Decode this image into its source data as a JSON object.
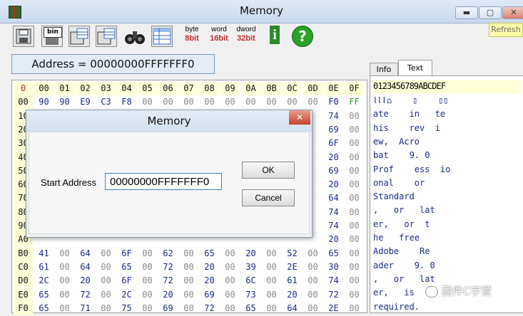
{
  "window": {
    "title": "Memory",
    "min": "▬",
    "max": "▢",
    "close": "✕"
  },
  "toolbar": {
    "byte_top": "byte",
    "byte_bot": "8bit",
    "word_top": "word",
    "word_bot": "16bit",
    "dword_top": "dword",
    "dword_bot": "32bit",
    "bin_label": "bin",
    "info_label": "i",
    "help_label": "?",
    "refresh_label": "Refresh"
  },
  "address": {
    "text": "Address = 00000000FFFFFFF0"
  },
  "tabs": {
    "info": "Info",
    "text": "Text"
  },
  "grid": {
    "corner": "0",
    "cols": [
      "00",
      "01",
      "02",
      "03",
      "04",
      "05",
      "06",
      "07",
      "08",
      "09",
      "0A",
      "0B",
      "0C",
      "0D",
      "0E",
      "0F"
    ],
    "rows": [
      {
        "label": "00",
        "cells": [
          "90",
          "90",
          "E9",
          "C3",
          "F8",
          "00",
          "00",
          "00",
          "00",
          "00",
          "00",
          "00",
          "00",
          "00",
          "F0",
          "FF"
        ]
      },
      {
        "label": "10",
        "cells": [
          "",
          "",
          "",
          "",
          "",
          "",
          "",
          "",
          "",
          "",
          "",
          "",
          "",
          "",
          "74",
          "00"
        ]
      },
      {
        "label": "20",
        "cells": [
          "",
          "",
          "",
          "",
          "",
          "",
          "",
          "",
          "",
          "",
          "",
          "",
          "",
          "",
          "69",
          "00"
        ]
      },
      {
        "label": "30",
        "cells": [
          "",
          "",
          "",
          "",
          "",
          "",
          "",
          "",
          "",
          "",
          "",
          "",
          "",
          "",
          "6F",
          "00"
        ]
      },
      {
        "label": "40",
        "cells": [
          "",
          "",
          "",
          "",
          "",
          "",
          "",
          "",
          "",
          "",
          "",
          "",
          "",
          "",
          "20",
          "00"
        ]
      },
      {
        "label": "50",
        "cells": [
          "",
          "",
          "",
          "",
          "",
          "",
          "",
          "",
          "",
          "",
          "",
          "",
          "",
          "",
          "69",
          "00"
        ]
      },
      {
        "label": "60",
        "cells": [
          "",
          "",
          "",
          "",
          "",
          "",
          "",
          "",
          "",
          "",
          "",
          "",
          "",
          "",
          "20",
          "00"
        ]
      },
      {
        "label": "70",
        "cells": [
          "",
          "",
          "",
          "",
          "",
          "",
          "",
          "",
          "",
          "",
          "",
          "",
          "",
          "",
          "64",
          "00"
        ]
      },
      {
        "label": "80",
        "cells": [
          "",
          "",
          "",
          "",
          "",
          "",
          "",
          "",
          "",
          "",
          "",
          "",
          "",
          "",
          "74",
          "00"
        ]
      },
      {
        "label": "90",
        "cells": [
          "",
          "",
          "",
          "",
          "",
          "",
          "",
          "",
          "",
          "",
          "",
          "",
          "",
          "",
          "74",
          "00"
        ]
      },
      {
        "label": "A0",
        "cells": [
          "",
          "",
          "",
          "",
          "",
          "",
          "",
          "",
          "",
          "",
          "",
          "",
          "",
          "",
          "20",
          "00"
        ]
      },
      {
        "label": "B0",
        "cells": [
          "41",
          "00",
          "64",
          "00",
          "6F",
          "00",
          "62",
          "00",
          "65",
          "00",
          "20",
          "00",
          "52",
          "00",
          "65",
          "00"
        ]
      },
      {
        "label": "C0",
        "cells": [
          "61",
          "00",
          "64",
          "00",
          "65",
          "00",
          "72",
          "00",
          "20",
          "00",
          "39",
          "00",
          "2E",
          "00",
          "30",
          "00"
        ]
      },
      {
        "label": "D0",
        "cells": [
          "2C",
          "00",
          "20",
          "00",
          "6F",
          "00",
          "72",
          "00",
          "20",
          "00",
          "6C",
          "00",
          "61",
          "00",
          "74",
          "00"
        ]
      },
      {
        "label": "E0",
        "cells": [
          "65",
          "00",
          "72",
          "00",
          "2C",
          "00",
          "20",
          "00",
          "69",
          "00",
          "73",
          "00",
          "20",
          "00",
          "72",
          "00"
        ]
      },
      {
        "label": "F0",
        "cells": [
          "65",
          "00",
          "71",
          "00",
          "75",
          "00",
          "69",
          "00",
          "72",
          "00",
          "65",
          "00",
          "64",
          "00",
          "2E",
          "00"
        ]
      }
    ]
  },
  "textpane": {
    "header": "0123456789ABCDEF",
    "rows": [
      "⌇⌇ǀ⌂    ▯    ▯▯",
      "ate    in   te",
      "his    rev  i",
      "ew,  Acro",
      "bat    9. 0",
      "Prof    ess  io",
      "onal    or",
      "Standard",
      ",   or   lat",
      "er,   or  t",
      "he   free",
      "Adobe    Re",
      "ader    9. 0",
      ",   or   lat",
      "er,   is",
      "required."
    ]
  },
  "dialog": {
    "title": "Memory",
    "close": "✕",
    "start_label": "Start Address",
    "start_value": "00000000FFFFFFF0",
    "ok": "OK",
    "cancel": "Cancel"
  },
  "watermark": "固件C字营"
}
